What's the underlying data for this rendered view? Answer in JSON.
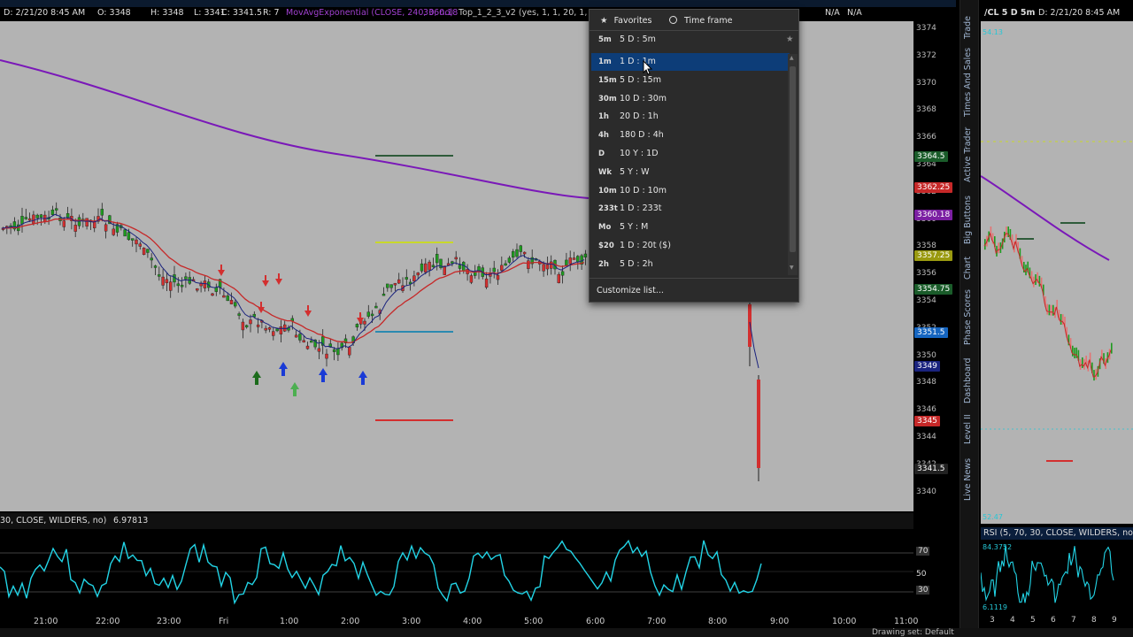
{
  "main_chart": {
    "header": {
      "date_label": "D: 2/21/20 8:45 AM",
      "open": "O: 3348",
      "high": "H: 3348",
      "low": "L: 3341",
      "close": "C: 3341.5",
      "range": "R: 7",
      "ma_study": "MovAvgExponential (CLOSE, 240, 0, no)",
      "ma_value": "3360.18",
      "top_study": "Top_1_2_3_v2 (yes, 1, 1, 20, 1, 1, ...",
      "na1": "N/A",
      "na2": "N/A"
    },
    "price_ticks": [
      "3374",
      "3372",
      "3370",
      "3368",
      "3366",
      "3364",
      "3362",
      "3360",
      "3358",
      "3356",
      "3354",
      "3352",
      "3350",
      "3348",
      "3346",
      "3344",
      "3342",
      "3340"
    ],
    "price_tags": [
      {
        "label": "3364.5",
        "bg": "#1a5c2a"
      },
      {
        "label": "3362.25",
        "bg": "#c62828"
      },
      {
        "label": "3360.18",
        "bg": "#7b1fa2"
      },
      {
        "label": "3357.25",
        "bg": "#9a9a10"
      },
      {
        "label": "3354.75",
        "bg": "#1a5c2a"
      },
      {
        "label": "3351.5",
        "bg": "#1565c0"
      },
      {
        "label": "3349",
        "bg": "#1a237e"
      },
      {
        "label": "3345",
        "bg": "#c62828"
      },
      {
        "label": "3341.5",
        "bg": "#222222"
      }
    ],
    "colors": {
      "background": "#b3b3b3",
      "ema240": "#7a18b8",
      "ema_fast": "#c62828",
      "ema_slow": "#1a237e",
      "up_candle": "#1f9a1f",
      "down_candle": "#d32f2f"
    }
  },
  "study": {
    "header": "30, CLOSE, WILDERS, no)",
    "value": "6.97813",
    "levels": [
      "70",
      "50",
      "30"
    ],
    "line_color": "#22d4e6"
  },
  "time_axis": [
    "21:00",
    "22:00",
    "23:00",
    "Fri",
    "1:00",
    "2:00",
    "3:00",
    "4:00",
    "5:00",
    "6:00",
    "7:00",
    "8:00",
    "9:00",
    "10:00",
    "11:00"
  ],
  "side_tabs": [
    "Trade",
    "Times And Sales",
    "Active Trader",
    "Big Buttons",
    "Chart",
    "Phase Scores",
    "Dashboard",
    "Level II",
    "Live News"
  ],
  "mini_chart": {
    "header": {
      "symbol": "/CL 5 D 5m",
      "date": "D: 2/21/20 8:45 AM"
    },
    "top_value": "54.13",
    "bottom_value": "52.47",
    "study_header": "RSI (5, 70, 30, CLOSE, WILDERS, no)",
    "study_top": "84.3752",
    "study_bottom": "6.1119",
    "time_labels": [
      "3",
      "4",
      "5",
      "6",
      "7",
      "8",
      "9"
    ]
  },
  "bottom_bar": {
    "drawing_set": "Drawing set: Default"
  },
  "dropdown": {
    "tabs": {
      "favorites": "Favorites",
      "time_frame": "Time frame"
    },
    "favorite_item": {
      "abbr": "5m",
      "label": "5 D : 5m"
    },
    "items": [
      {
        "abbr": "1m",
        "label": "1 D : 1m",
        "selected": true
      },
      {
        "abbr": "15m",
        "label": "5 D : 15m"
      },
      {
        "abbr": "30m",
        "label": "10 D : 30m"
      },
      {
        "abbr": "1h",
        "label": "20 D : 1h"
      },
      {
        "abbr": "4h",
        "label": "180 D : 4h"
      },
      {
        "abbr": "D",
        "label": "10 Y : 1D"
      },
      {
        "abbr": "Wk",
        "label": "5 Y : W"
      },
      {
        "abbr": "10m",
        "label": "10 D : 10m"
      },
      {
        "abbr": "233t",
        "label": "1 D : 233t"
      },
      {
        "abbr": "Mo",
        "label": "5 Y : M"
      },
      {
        "abbr": "$20",
        "label": "1 D : 20t ($)"
      },
      {
        "abbr": "2h",
        "label": "5 D : 2h"
      }
    ],
    "customize": "Customize list..."
  }
}
